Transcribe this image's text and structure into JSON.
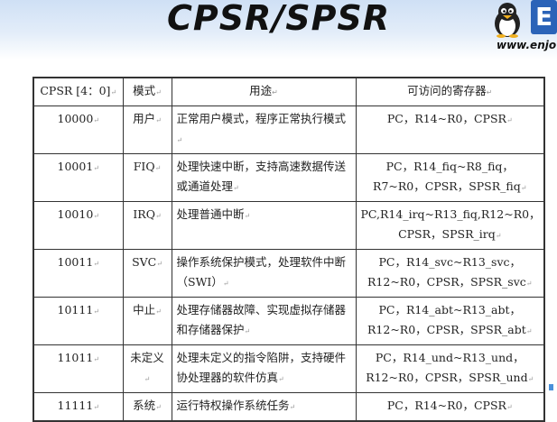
{
  "header": {
    "title": "CPSR/SPSR",
    "site": "www.enjo"
  },
  "logo": {
    "letter": "E"
  },
  "table": {
    "headers": [
      "CPSR [4：0]",
      "模式",
      "用途",
      "可访问的寄存器"
    ],
    "rows": [
      {
        "cpsr": "10000",
        "mode": "用户",
        "use": "正常用户模式，程序正常执行模式",
        "regs": "PC，R14~R0，CPSR"
      },
      {
        "cpsr": "10001",
        "mode": "FIQ",
        "use": "处理快速中断，支持高速数据传送或通道处理",
        "regs": "PC，R14_fiq~R8_fiq，R7~R0，CPSR，SPSR_fiq"
      },
      {
        "cpsr": "10010",
        "mode": "IRQ",
        "use": "处理普通中断",
        "regs": "PC,R14_irq~R13_fiq,R12~R0，CPSR，SPSR_irq"
      },
      {
        "cpsr": "10011",
        "mode": "SVC",
        "use": "操作系统保护模式，处理软件中断（SWI）",
        "regs": "PC，R14_svc~R13_svc，R12~R0，CPSR，SPSR_svc"
      },
      {
        "cpsr": "10111",
        "mode": "中止",
        "use": "处理存储器故障、实现虚拟存储器和存储器保护",
        "regs": "PC，R14_abt~R13_abt，R12~R0，CPSR，SPSR_abt"
      },
      {
        "cpsr": "11011",
        "mode": "未定义",
        "use": "处理未定义的指令陷阱，支持硬件协处理器的软件仿真",
        "regs": "PC，R14_und~R13_und，R12~R0，CPSR，SPSR_und"
      },
      {
        "cpsr": "11111",
        "mode": "系统",
        "use": "运行特权操作系统任务",
        "regs": "PC，R14~R0，CPSR"
      }
    ]
  },
  "colors": {
    "logo_blue": "#2b63b8",
    "header_band": "#cfe0f5"
  }
}
